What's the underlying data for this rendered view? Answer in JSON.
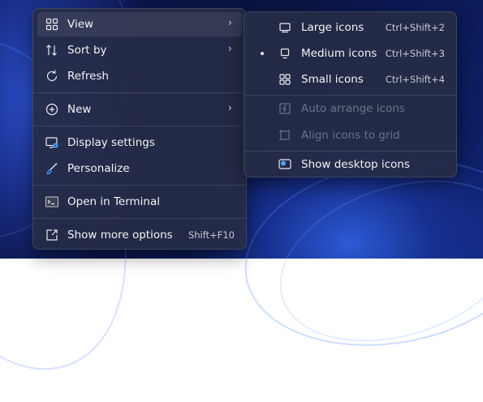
{
  "context_menu": {
    "items": [
      {
        "label": "View",
        "icon": "grid-icon",
        "submenu": true
      },
      {
        "label": "Sort by",
        "icon": "sort-icon",
        "submenu": true
      },
      {
        "label": "Refresh",
        "icon": "refresh-icon"
      },
      {
        "label": "New",
        "icon": "plus-circle-icon",
        "submenu": true
      },
      {
        "label": "Display settings",
        "icon": "display-settings-icon"
      },
      {
        "label": "Personalize",
        "icon": "brush-icon"
      },
      {
        "label": "Open in Terminal",
        "icon": "terminal-icon"
      },
      {
        "label": "Show more options",
        "icon": "external-icon",
        "shortcut": "Shift+F10"
      }
    ]
  },
  "view_submenu": {
    "items": [
      {
        "label": "Large icons",
        "icon": "monitor-large-icon",
        "shortcut": "Ctrl+Shift+2"
      },
      {
        "label": "Medium icons",
        "icon": "monitor-medium-icon",
        "shortcut": "Ctrl+Shift+3",
        "selected": true
      },
      {
        "label": "Small icons",
        "icon": "grid-small-icon",
        "shortcut": "Ctrl+Shift+4"
      },
      {
        "label": "Auto arrange icons",
        "icon": "auto-arrange-icon",
        "disabled": true
      },
      {
        "label": "Align icons to grid",
        "icon": "align-grid-icon",
        "disabled": true
      },
      {
        "label": "Show desktop icons",
        "icon": "show-desktop-icon"
      }
    ]
  },
  "colors": {
    "accent": "#4aa3ff",
    "menu_bg": "#262c46",
    "text": "#f2f3f7",
    "disabled_text": "#6c7388"
  }
}
